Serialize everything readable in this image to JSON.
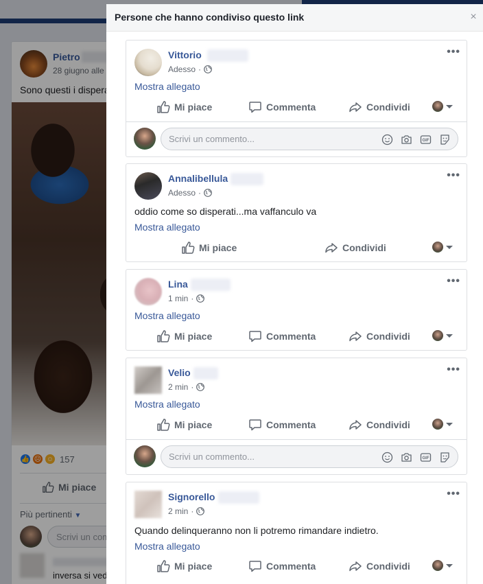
{
  "background": {
    "author": "Pietro",
    "date": "28 giugno alle",
    "post_text": "Sono questi i dispera",
    "reaction_count": "157",
    "like_label": "Mi piace",
    "sort_label": "Più pertinenti",
    "comment_placeholder": "Scrivi un com",
    "comment_text": "inversa si ved"
  },
  "modal": {
    "title": "Persone che hanno condiviso questo link",
    "close": "×"
  },
  "labels": {
    "like": "Mi piace",
    "comment": "Commenta",
    "share": "Condividi",
    "show_attachment": "Mostra allegato",
    "comment_placeholder": "Scrivi un commento..."
  },
  "shares": [
    {
      "name": "Vittorio",
      "time": "Adesso",
      "text": ""
    },
    {
      "name": "Annalibellula",
      "time": "Adesso",
      "text": "oddio come so disperati...ma vaffanculo va"
    },
    {
      "name": "Lina",
      "time": "1 min",
      "text": ""
    },
    {
      "name": "Velio",
      "time": "2 min",
      "text": ""
    },
    {
      "name": "Signorello",
      "time": "2 min",
      "text": "Quando delinqueranno non li potremo rimandare indietro."
    }
  ],
  "colors": {
    "link": "#385898",
    "header_blue": "#1d3c74",
    "muted": "#606770"
  }
}
